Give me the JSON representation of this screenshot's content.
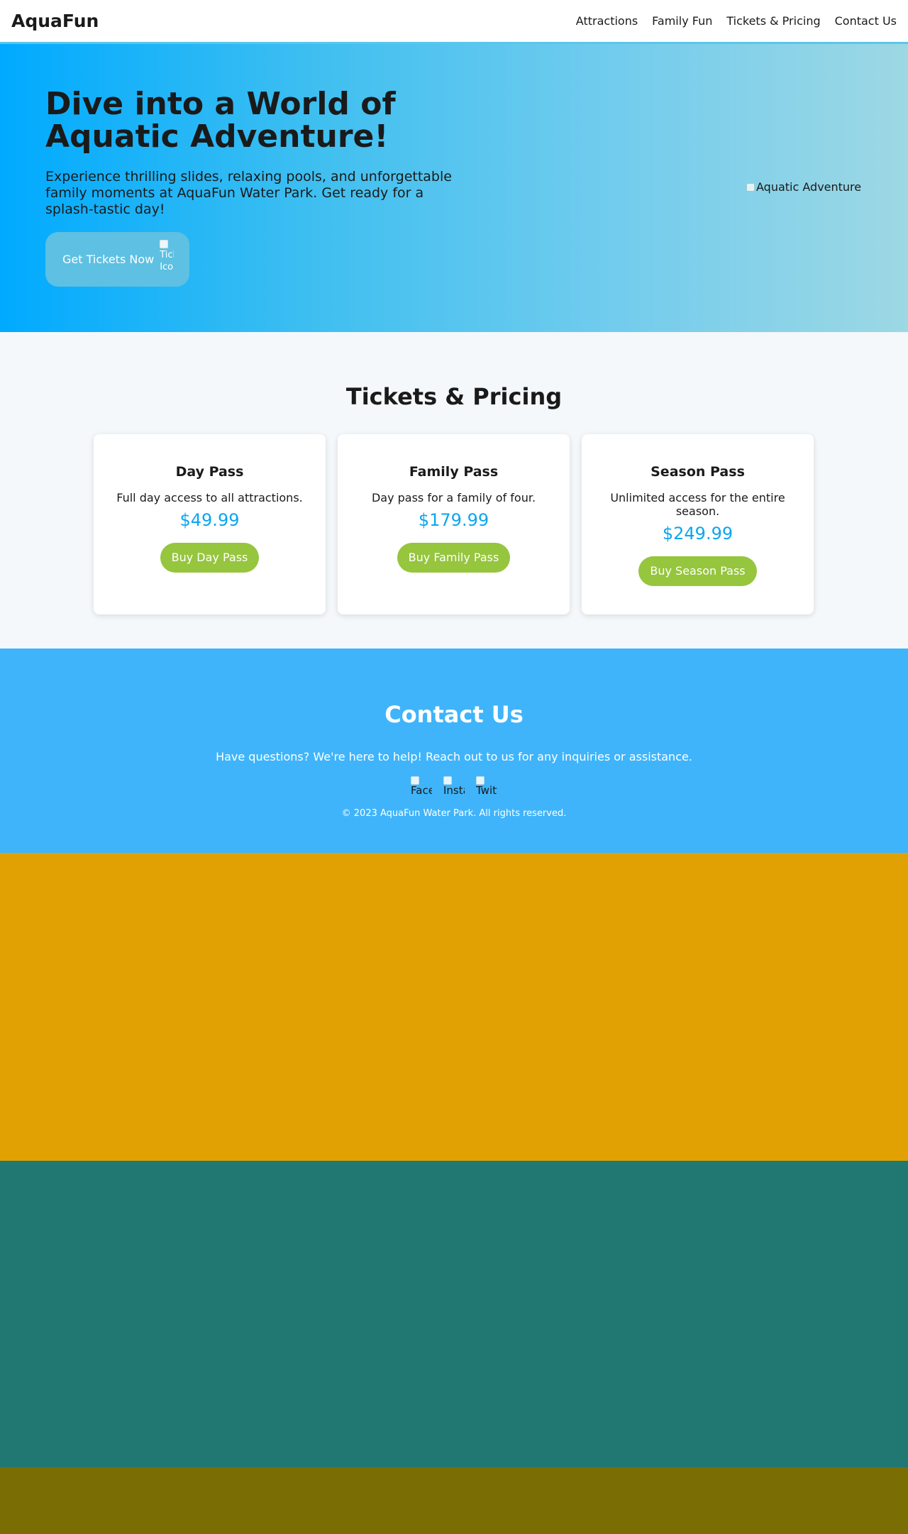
{
  "header": {
    "logo": "AquaFun",
    "nav": [
      "Attractions",
      "Family Fun",
      "Tickets & Pricing",
      "Contact Us"
    ]
  },
  "hero": {
    "title": "Dive into a World of Aquatic Adventure!",
    "text": "Experience thrilling slides, relaxing pools, and unforgettable family moments at AquaFun Water Park. Get ready for a splash-tastic day!",
    "cta_label": "Get Tickets Now",
    "cta_icon_alt": "Ticket Icon",
    "image_alt": "Aquatic Adventure"
  },
  "pricing": {
    "title": "Tickets & Pricing",
    "cards": [
      {
        "name": "Day Pass",
        "desc": "Full day access to all attractions.",
        "price": "$49.99",
        "button": "Buy Day Pass"
      },
      {
        "name": "Family Pass",
        "desc": "Day pass for a family of four.",
        "price": "$179.99",
        "button": "Buy Family Pass"
      },
      {
        "name": "Season Pass",
        "desc": "Unlimited access for the entire season.",
        "price": "$249.99",
        "button": "Buy Season Pass"
      }
    ]
  },
  "contact": {
    "title": "Contact Us",
    "text": "Have questions? We're here to help! Reach out to us for any inquiries or assistance.",
    "socials": [
      "Facebook",
      "Instagram",
      "Twitter"
    ],
    "copyright": "© 2023 AquaFun Water Park. All rights reserved."
  },
  "colors": {
    "accent": "#0aa6ee",
    "button_green": "#96c53e",
    "contact_bg": "#3fb4fb",
    "band_1": "#e1a103",
    "band_2": "#217873",
    "band_3": "#7a6d03"
  }
}
